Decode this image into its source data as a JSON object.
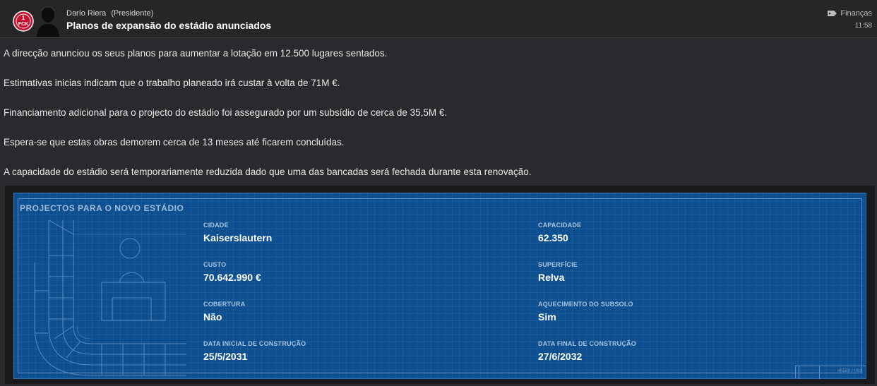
{
  "header": {
    "sender_name": "Darío Riera",
    "sender_role": "(Presidente)",
    "subject": "Planos de expansão do estádio anunciados",
    "category": "Finanças",
    "time": "11:58",
    "club_badge_text": "1FCK",
    "club_color": "#c8102e"
  },
  "paragraphs": [
    "A direcção anunciou os seus planos para aumentar a lotação em 12.500 lugares sentados.",
    "Estimativas inicias indicam que o trabalho planeado irá custar à volta de 71M €.",
    "Financiamento adicional para o projecto do estádio foi assegurado por um subsídio de cerca de 35,5M €.",
    "Espera-se que estas obras demorem cerca de 13 meses até ficarem concluídas.",
    "A capacidade do estádio será temporariamente reduzida dado que uma das bancadas será fechada durante esta renovação."
  ],
  "blueprint": {
    "title": "PROJECTOS PARA O NOVO ESTÁDIO",
    "stamp_code": "46588 / 092",
    "fields": {
      "city": {
        "label": "CIDADE",
        "value": "Kaiserslautern"
      },
      "capacity": {
        "label": "CAPACIDADE",
        "value": "62.350"
      },
      "cost": {
        "label": "CUSTO",
        "value": "70.642.990 €"
      },
      "surface": {
        "label": "SUPERFÍCIE",
        "value": "Relva"
      },
      "roof": {
        "label": "COBERTURA",
        "value": "Não"
      },
      "heating": {
        "label": "AQUECIMENTO DO SUBSOLO",
        "value": "Sim"
      },
      "start": {
        "label": "DATA INICIAL DE CONSTRUÇÃO",
        "value": "25/5/2031"
      },
      "end": {
        "label": "DATA FINAL DE CONSTRUÇÃO",
        "value": "27/6/2032"
      }
    }
  },
  "colors": {
    "background": "#2a2a2e",
    "blueprint": "#0d4f8f",
    "blueprint_line": "#5d8fc4"
  },
  "icons": {
    "category": "tag-icon",
    "avatar": "person-silhouette-icon",
    "badge": "club-badge-icon"
  }
}
